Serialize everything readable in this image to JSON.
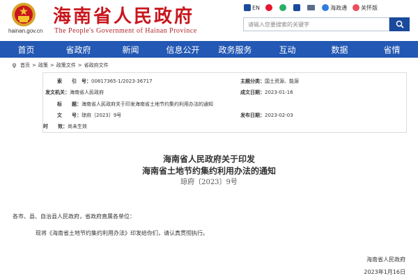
{
  "header": {
    "site_title": "海南省人民政府",
    "site_subtitle": "The People's Government  of  Hainan Province",
    "domain": "hainan.gov.cn"
  },
  "toolbar": {
    "items": [
      {
        "label": "EN",
        "icon": "english-icon"
      },
      {
        "label": "",
        "icon": "weibo-icon"
      },
      {
        "label": "",
        "icon": "wechat-icon"
      },
      {
        "label": "",
        "icon": "app-icon"
      },
      {
        "label": "",
        "icon": "mail-icon"
      },
      {
        "label": "海政通",
        "icon": "haizhengtong-icon"
      },
      {
        "label": "关怀版",
        "icon": "care-mode-icon"
      }
    ]
  },
  "search": {
    "placeholder": "请输入您要搜索的关键字"
  },
  "nav": {
    "items": [
      "首页",
      "省政府",
      "新闻",
      "信息公开",
      "政务服务",
      "互动",
      "数据",
      "省情"
    ]
  },
  "breadcrumb": [
    "首页",
    "政策",
    "政策文件",
    "省政府文件"
  ],
  "info": {
    "index_label": "索　　引　号：",
    "index_value": "00817365-1/2023-36717",
    "category_label": "主题分类：",
    "category_value": "国土资源、能源",
    "issuer_label": "发文机关：",
    "issuer_value": "海南省人民政府",
    "written_label": "成文日期：",
    "written_value": "2023-01-16",
    "title_label": "标　　题：",
    "title_value": "海南省人民政府关于印发海南省土地节约集约利用办法的通知",
    "docno_label": "文　　号：",
    "docno_value": "琼府〔2023〕9号",
    "publish_label": "发布日期：",
    "publish_value": "2023-02-03",
    "validity_label": "时　　效：",
    "validity_value": "尚未生效"
  },
  "document": {
    "title_line1": "海南省人民政府关于印发",
    "title_line2": "海南省土地节约集约利用办法的通知",
    "number": "琼府〔2023〕9号",
    "salutation": "各市、县、自治县人民政府，省政府直属各单位：",
    "body": "现将《海南省土地节约集约利用办法》印发给你们，请认真贯彻执行。",
    "sign_org": "海南省人民政府",
    "sign_date": "2023年1月16日"
  },
  "colors": {
    "brand_red": "#c8161d",
    "nav_blue": "#2358b4",
    "search_blue": "#1a4a9c"
  }
}
